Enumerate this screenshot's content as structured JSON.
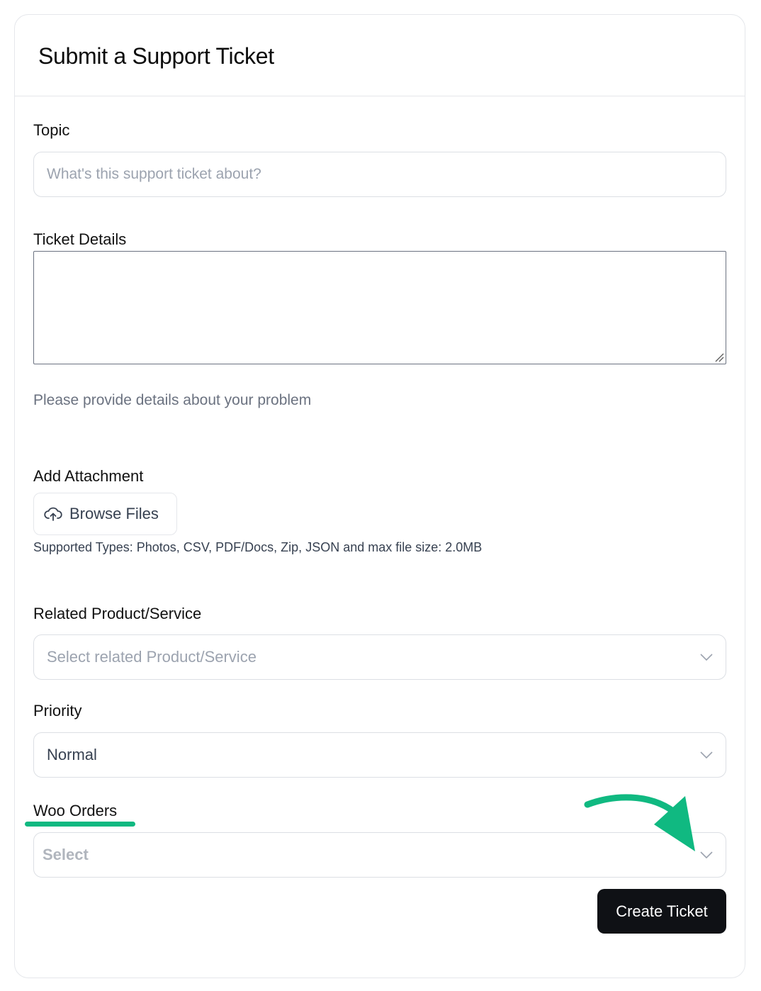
{
  "header": {
    "title": "Submit a Support Ticket"
  },
  "topic": {
    "label": "Topic",
    "placeholder": "What's this support ticket about?"
  },
  "details": {
    "label": "Ticket Details",
    "help": "Please provide details about your problem"
  },
  "attachment": {
    "label": "Add Attachment",
    "browse_label": "Browse Files",
    "supported_types": "Supported Types: Photos, CSV, PDF/Docs, Zip, JSON and max file size: 2.0MB"
  },
  "product": {
    "label": "Related Product/Service",
    "placeholder": "Select related Product/Service"
  },
  "priority": {
    "label": "Priority",
    "value": "Normal"
  },
  "woo_orders": {
    "label": "Woo Orders",
    "placeholder": "Select"
  },
  "actions": {
    "create_label": "Create Ticket"
  },
  "colors": {
    "accent": "#10b981",
    "primary_button": "#0f1115"
  }
}
